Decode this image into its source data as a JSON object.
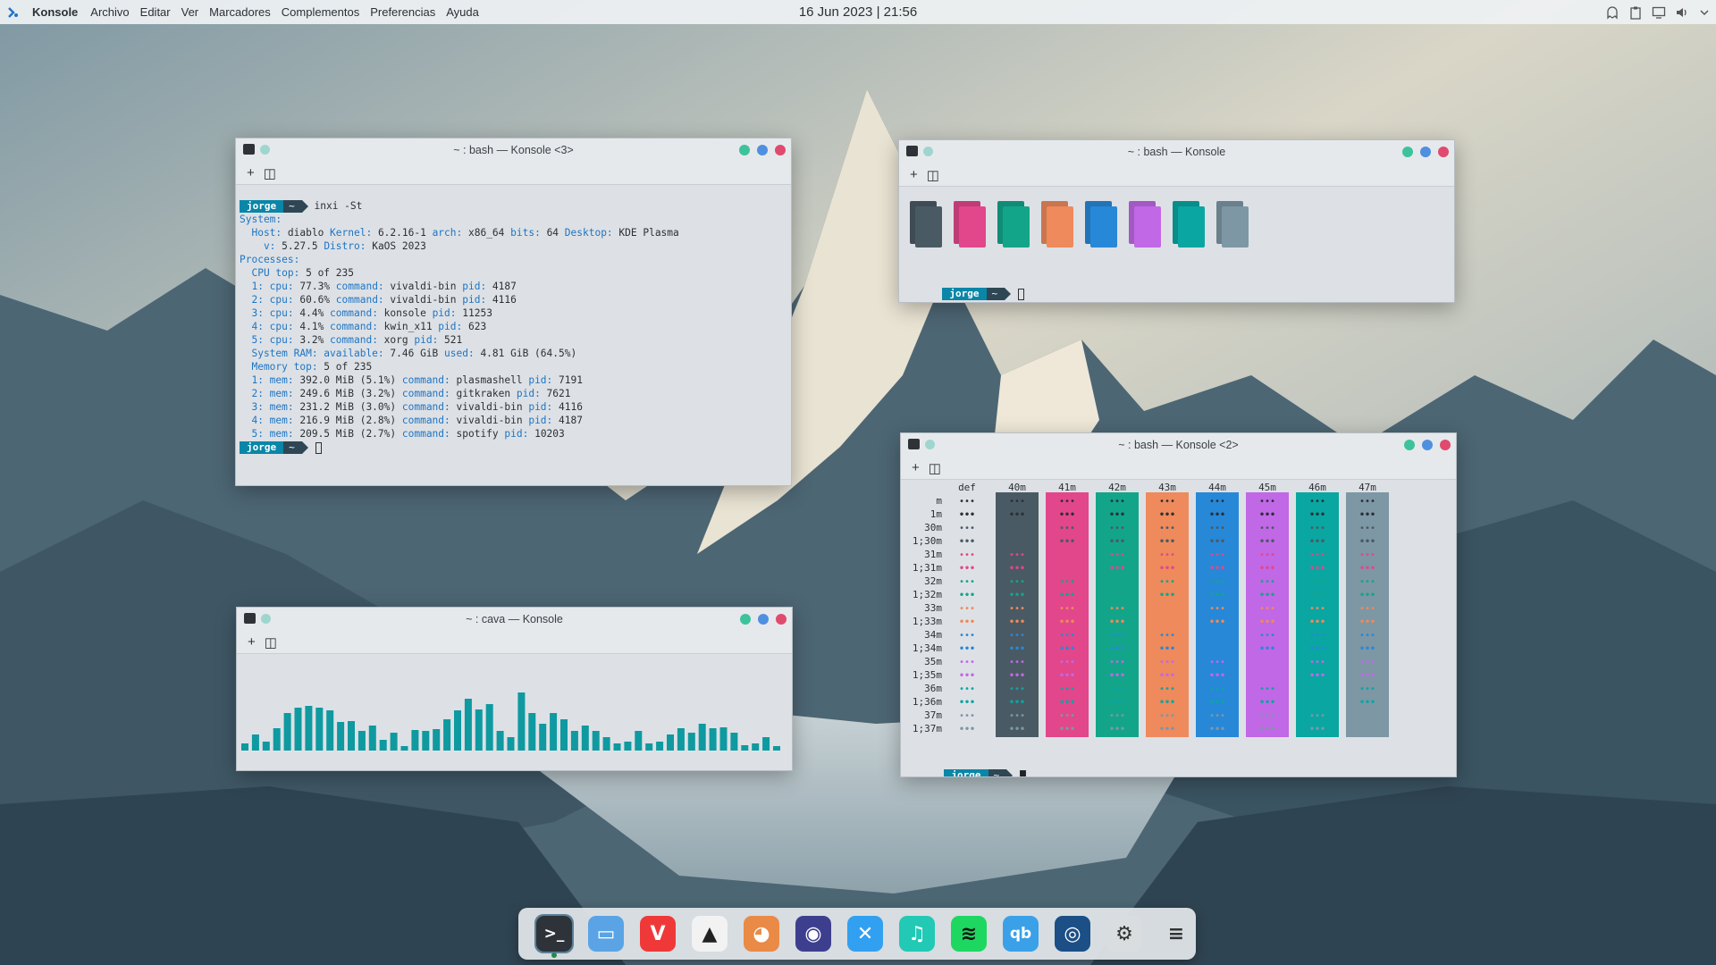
{
  "topbar": {
    "app": "Konsole",
    "menus": [
      "Archivo",
      "Editar",
      "Ver",
      "Marcadores",
      "Complementos",
      "Preferencias",
      "Ayuda"
    ],
    "clock": "16 Jun 2023 | 21:56",
    "tray_icons": [
      "ghost-icon",
      "clipboard-icon",
      "display-icon",
      "volume-icon",
      "chevron-down-icon"
    ]
  },
  "colors": {
    "accent": "#0a86a8",
    "btn_green": "#3cc39c",
    "btn_blue": "#4f8fe0",
    "btn_red": "#e04a6e",
    "palette": [
      "#4a5a64",
      "#e2478b",
      "#13a58a",
      "#ee8a5b",
      "#2788d8",
      "#c168e6",
      "#0aa6a2",
      "#7d97a5"
    ]
  },
  "win_inxi": {
    "title": "~ : bash — Konsole <3>",
    "prompt_user": "jorge",
    "prompt_path": "~",
    "command": "inxi -St",
    "lines": [
      [
        [
          "k",
          "System:"
        ]
      ],
      [
        [
          "k",
          "  Host:"
        ],
        [
          "t",
          " diablo "
        ],
        [
          "k",
          "Kernel:"
        ],
        [
          "t",
          " 6.2.16-1 "
        ],
        [
          "k",
          "arch:"
        ],
        [
          "t",
          " x86_64 "
        ],
        [
          "k",
          "bits:"
        ],
        [
          "t",
          " 64 "
        ],
        [
          "k",
          "Desktop:"
        ],
        [
          "t",
          " KDE Plasma"
        ]
      ],
      [
        [
          "k",
          "    v:"
        ],
        [
          "t",
          " 5.27.5 "
        ],
        [
          "k",
          "Distro:"
        ],
        [
          "t",
          " KaOS 2023"
        ]
      ],
      [
        [
          "k",
          "Processes:"
        ]
      ],
      [
        [
          "k",
          "  CPU top:"
        ],
        [
          "t",
          " 5 of 235"
        ]
      ],
      [
        [
          "k",
          "  1: cpu:"
        ],
        [
          "t",
          " 77.3% "
        ],
        [
          "k",
          "command:"
        ],
        [
          "t",
          " vivaldi-bin "
        ],
        [
          "k",
          "pid:"
        ],
        [
          "t",
          " 4187"
        ]
      ],
      [
        [
          "k",
          "  2: cpu:"
        ],
        [
          "t",
          " 60.6% "
        ],
        [
          "k",
          "command:"
        ],
        [
          "t",
          " vivaldi-bin "
        ],
        [
          "k",
          "pid:"
        ],
        [
          "t",
          " 4116"
        ]
      ],
      [
        [
          "k",
          "  3: cpu:"
        ],
        [
          "t",
          " 4.4% "
        ],
        [
          "k",
          "command:"
        ],
        [
          "t",
          " konsole "
        ],
        [
          "k",
          "pid:"
        ],
        [
          "t",
          " 11253"
        ]
      ],
      [
        [
          "k",
          "  4: cpu:"
        ],
        [
          "t",
          " 4.1% "
        ],
        [
          "k",
          "command:"
        ],
        [
          "t",
          " kwin_x11 "
        ],
        [
          "k",
          "pid:"
        ],
        [
          "t",
          " 623"
        ]
      ],
      [
        [
          "k",
          "  5: cpu:"
        ],
        [
          "t",
          " 3.2% "
        ],
        [
          "k",
          "command:"
        ],
        [
          "t",
          " xorg "
        ],
        [
          "k",
          "pid:"
        ],
        [
          "t",
          " 521"
        ]
      ],
      [
        [
          "k",
          "  System RAM: available:"
        ],
        [
          "t",
          " 7.46 GiB "
        ],
        [
          "k",
          "used:"
        ],
        [
          "t",
          " 4.81 GiB (64.5%)"
        ]
      ],
      [
        [
          "k",
          "  Memory top:"
        ],
        [
          "t",
          " 5 of 235"
        ]
      ],
      [
        [
          "k",
          "  1: mem:"
        ],
        [
          "t",
          " 392.0 MiB (5.1%) "
        ],
        [
          "k",
          "command:"
        ],
        [
          "t",
          " plasmashell "
        ],
        [
          "k",
          "pid:"
        ],
        [
          "t",
          " 7191"
        ]
      ],
      [
        [
          "k",
          "  2: mem:"
        ],
        [
          "t",
          " 249.6 MiB (3.2%) "
        ],
        [
          "k",
          "command:"
        ],
        [
          "t",
          " gitkraken "
        ],
        [
          "k",
          "pid:"
        ],
        [
          "t",
          " 7621"
        ]
      ],
      [
        [
          "k",
          "  3: mem:"
        ],
        [
          "t",
          " 231.2 MiB (3.0%) "
        ],
        [
          "k",
          "command:"
        ],
        [
          "t",
          " vivaldi-bin "
        ],
        [
          "k",
          "pid:"
        ],
        [
          "t",
          " 4116"
        ]
      ],
      [
        [
          "k",
          "  4: mem:"
        ],
        [
          "t",
          " 216.9 MiB (2.8%) "
        ],
        [
          "k",
          "command:"
        ],
        [
          "t",
          " vivaldi-bin "
        ],
        [
          "k",
          "pid:"
        ],
        [
          "t",
          " 4187"
        ]
      ],
      [
        [
          "k",
          "  5: mem:"
        ],
        [
          "t",
          " 209.5 MiB (2.7%) "
        ],
        [
          "k",
          "command:"
        ],
        [
          "t",
          " spotify "
        ],
        [
          "k",
          "pid:"
        ],
        [
          "t",
          " 10203"
        ]
      ]
    ]
  },
  "win_palette": {
    "title": "~ : bash — Konsole",
    "prompt_user": "jorge",
    "prompt_path": "~"
  },
  "win_cava": {
    "title": "~ : cava — Konsole",
    "levels": [
      0.08,
      0.18,
      0.1,
      0.25,
      0.42,
      0.48,
      0.5,
      0.48,
      0.45,
      0.32,
      0.33,
      0.22,
      0.28,
      0.12,
      0.2,
      0.05,
      0.23,
      0.22,
      0.24,
      0.35,
      0.45,
      0.58,
      0.46,
      0.52,
      0.22,
      0.15,
      0.65,
      0.42,
      0.3,
      0.42,
      0.35,
      0.22,
      0.28,
      0.22,
      0.15,
      0.08,
      0.1,
      0.22,
      0.08,
      0.1,
      0.18,
      0.25,
      0.2,
      0.3,
      0.25,
      0.26,
      0.2,
      0.06,
      0.08,
      0.15,
      0.05
    ]
  },
  "win_colors": {
    "title": "~ : bash — Konsole <2>",
    "prompt_user": "jorge",
    "prompt_path": "~",
    "col_headers": [
      "def",
      "40m",
      "41m",
      "42m",
      "43m",
      "44m",
      "45m",
      "46m",
      "47m"
    ],
    "row_labels": [
      "m",
      "1m",
      "30m",
      "1;30m",
      "31m",
      "1;31m",
      "32m",
      "1;32m",
      "33m",
      "1;33m",
      "34m",
      "1;34m",
      "35m",
      "1;35m",
      "36m",
      "1;36m",
      "37m",
      "1;37m"
    ],
    "cell_text": "•••",
    "fg_colors": [
      "#2b3035",
      "#2b3035",
      "#4a5a64",
      "#4a5a64",
      "#e2478b",
      "#e2478b",
      "#13a58a",
      "#13a58a",
      "#ee8a5b",
      "#ee8a5b",
      "#2788d8",
      "#2788d8",
      "#c168e6",
      "#c168e6",
      "#0aa6a2",
      "#0aa6a2",
      "#7d97a5",
      "#7d97a5"
    ]
  },
  "dock": {
    "apps": [
      {
        "name": "konsole",
        "icon": "terminal-icon",
        "glyph": ">_",
        "bg": "#2d3338",
        "active": true
      },
      {
        "name": "files",
        "icon": "folder-icon",
        "glyph": "▭",
        "bg": "#5aa4e6"
      },
      {
        "name": "vivaldi",
        "icon": "vivaldi-icon",
        "glyph": "V",
        "bg": "#ef3939"
      },
      {
        "name": "inkscape",
        "icon": "inkscape-icon",
        "glyph": "▲",
        "bg": "#f2f2f2",
        "fg": "#222"
      },
      {
        "name": "gimp",
        "icon": "gimp-icon",
        "glyph": "◕",
        "bg": "#e98a46"
      },
      {
        "name": "gitkraken",
        "icon": "gitkraken-icon",
        "glyph": "◉",
        "bg": "#3d3f8e"
      },
      {
        "name": "kdeconnect",
        "icon": "bird-icon",
        "glyph": "✕",
        "bg": "#32a0f0"
      },
      {
        "name": "music",
        "icon": "music-icon",
        "glyph": "♫",
        "bg": "#22c9b5"
      },
      {
        "name": "spotify",
        "icon": "spotify-icon",
        "glyph": "≋",
        "bg": "#1ed760",
        "fg": "#111"
      },
      {
        "name": "qbittorrent",
        "icon": "qbittorrent-icon",
        "glyph": "qb",
        "bg": "#3aa0e8"
      },
      {
        "name": "steam",
        "icon": "steam-icon",
        "glyph": "◎",
        "bg": "#1b4f86"
      },
      {
        "name": "settings",
        "icon": "gear-icon",
        "glyph": "⚙",
        "bg": "#d9dde0",
        "fg": "#333"
      },
      {
        "name": "menu",
        "icon": "menu-icon",
        "glyph": "≡",
        "bg": "transparent",
        "fg": "#333"
      }
    ]
  }
}
